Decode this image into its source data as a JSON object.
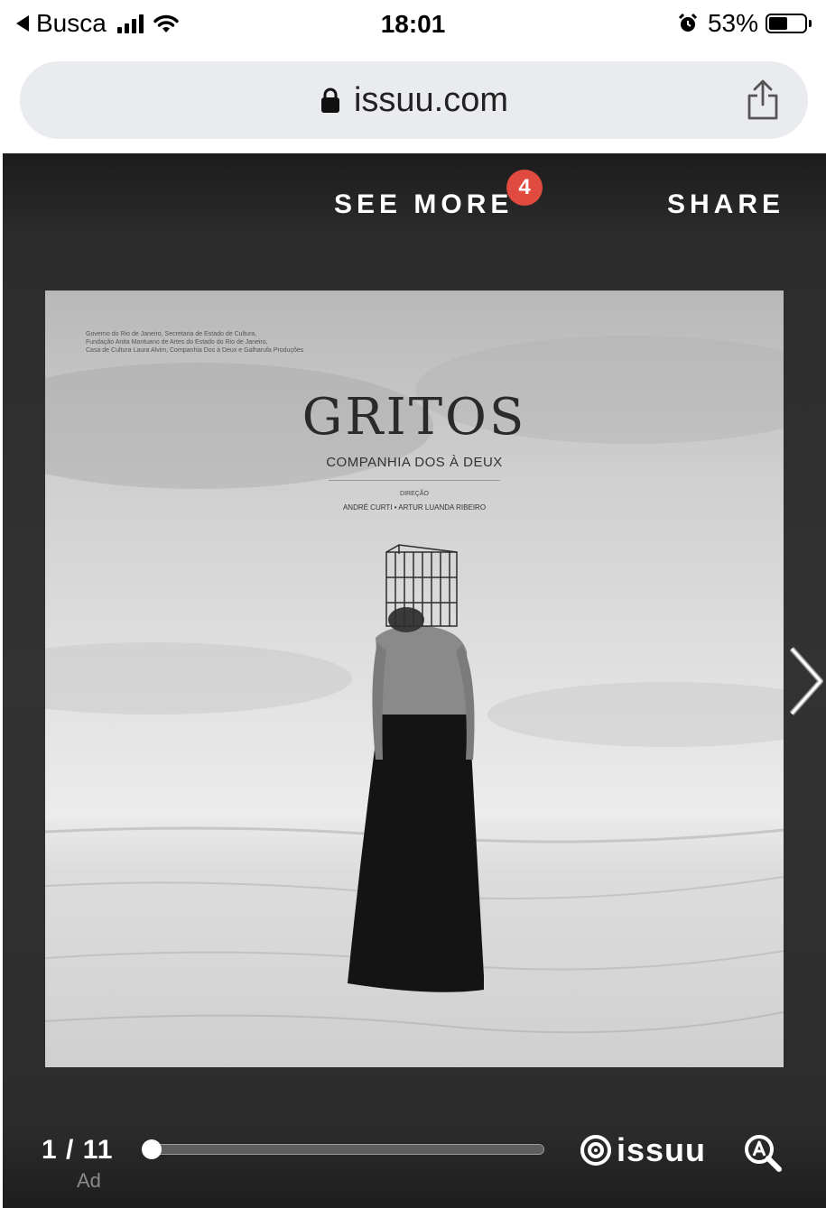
{
  "status_bar": {
    "back_label": "Busca",
    "time": "18:01",
    "battery_percent": "53%",
    "battery_level": 0.53,
    "icons": [
      "back-arrow-icon",
      "cellular-signal-icon",
      "wifi-icon",
      "alarm-icon",
      "battery-icon"
    ]
  },
  "browser": {
    "url": "issuu.com",
    "icons": [
      "lock-icon",
      "share-icon"
    ]
  },
  "viewer": {
    "see_more_label": "SEE MORE",
    "see_more_badge": "4",
    "share_label": "SHARE",
    "badge_color": "#e04a3f",
    "page_counter": "1 / 11",
    "ad_label": "Ad",
    "progress": 0.0,
    "brand": "issuu",
    "icons": [
      "next-page-icon",
      "issuu-logo-icon",
      "zoom-icon"
    ]
  },
  "poster": {
    "credits": [
      "Governo do Rio de Janeiro, Secretaria de Estado de Cultura,",
      "Fundação Anita Mantuano de Artes do Estado do Rio de Janeiro,",
      "Casa de Cultura Laura Alvim, Companhia Dos à Deux e Galharufa Produções"
    ],
    "title": "GRITOS",
    "subtitle": "COMPANHIA DOS À DEUX",
    "direction_label": "DIREÇÃO",
    "directors": "ANDRÉ CURTI • ARTUR LUANDA RIBEIRO"
  }
}
